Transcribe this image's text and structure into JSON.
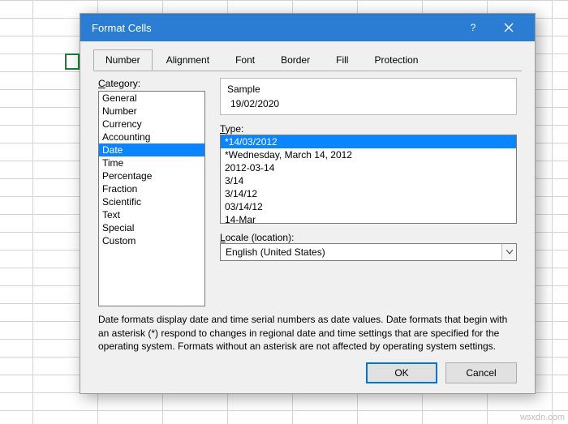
{
  "window": {
    "title": "Format Cells",
    "help_label": "?",
    "close_label": "×"
  },
  "tabs": {
    "items": [
      "Number",
      "Alignment",
      "Font",
      "Border",
      "Fill",
      "Protection"
    ],
    "active_index": 0
  },
  "category": {
    "label": "Category:",
    "items": [
      "General",
      "Number",
      "Currency",
      "Accounting",
      "Date",
      "Time",
      "Percentage",
      "Fraction",
      "Scientific",
      "Text",
      "Special",
      "Custom"
    ],
    "selected_index": 4
  },
  "sample": {
    "caption": "Sample",
    "value": "19/02/2020"
  },
  "type": {
    "label": "Type:",
    "items": [
      "*14/03/2012",
      "*Wednesday, March 14, 2012",
      "2012-03-14",
      "3/14",
      "3/14/12",
      "03/14/12",
      "14-Mar"
    ],
    "selected_index": 0
  },
  "locale": {
    "label": "Locale (location):",
    "value": "English (United States)"
  },
  "description": "Date formats display date and time serial numbers as date values. Date formats that begin with an asterisk (*) respond to changes in regional date and time settings that are specified for the operating system. Formats without an asterisk are not affected by operating system settings.",
  "buttons": {
    "ok": "OK",
    "cancel": "Cancel"
  },
  "watermark": "wsxdn.com"
}
